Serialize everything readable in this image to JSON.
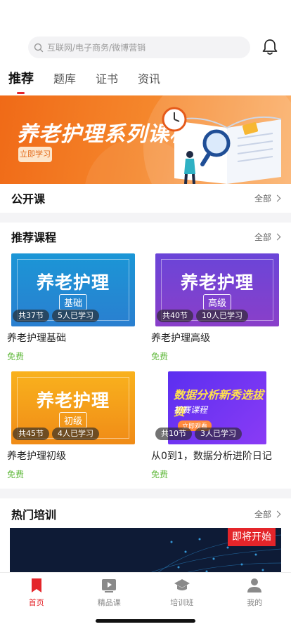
{
  "search": {
    "placeholder": "互联网/电子商务/微博营销"
  },
  "tabs": [
    {
      "label": "推荐",
      "active": true
    },
    {
      "label": "题库"
    },
    {
      "label": "证书"
    },
    {
      "label": "资讯"
    }
  ],
  "banner": {
    "title": "养老护理系列课程",
    "cta": "立即学习"
  },
  "open_course": {
    "title": "公开课",
    "more": "全部"
  },
  "recommended": {
    "title": "推荐课程",
    "more": "全部",
    "courses": [
      {
        "thumb_title": "养老护理",
        "level": "基础",
        "lessons": "共37节",
        "learners": "5人已学习",
        "title": "养老护理基础",
        "price": "免费"
      },
      {
        "thumb_title": "养老护理",
        "level": "高级",
        "lessons": "共40节",
        "learners": "10人已学习",
        "title": "养老护理高级",
        "price": "免费"
      },
      {
        "thumb_title": "养老护理",
        "level": "初级",
        "lessons": "共45节",
        "learners": "4人已学习",
        "title": "养老护理初级",
        "price": "免费"
      },
      {
        "thumb_title": "数据分析新秀选拔赛",
        "thumb_sub": "初赛课程",
        "thumb_btn": "立即观看",
        "lessons": "共10节",
        "learners": "3人已学习",
        "title": "从0到1，数据分析进阶日记",
        "price": "免费"
      }
    ]
  },
  "hot": {
    "title": "热门培训",
    "more": "全部",
    "badge": "即将开始"
  },
  "nav": [
    {
      "label": "首页",
      "active": true
    },
    {
      "label": "精品课"
    },
    {
      "label": "培训班"
    },
    {
      "label": "我的"
    }
  ],
  "colors": {
    "accent": "#e4252a",
    "free": "#5fb83a",
    "banner": "#f5872c"
  }
}
